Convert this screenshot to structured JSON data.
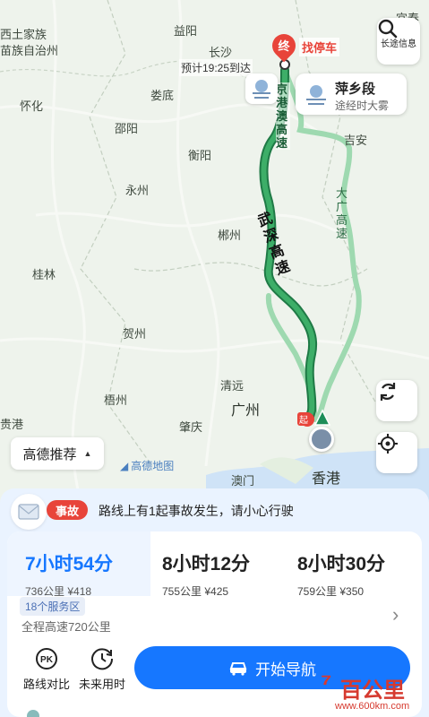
{
  "map": {
    "cities": [
      {
        "name": "西土家族",
        "cls": "city"
      },
      {
        "name": "苗族自治州",
        "cls": "city"
      },
      {
        "name": "益阳",
        "cls": "city"
      },
      {
        "name": "长沙",
        "cls": "city"
      },
      {
        "name": "怀化",
        "cls": "city"
      },
      {
        "name": "娄底",
        "cls": "city"
      },
      {
        "name": "邵阳",
        "cls": "city"
      },
      {
        "name": "衡阳",
        "cls": "city"
      },
      {
        "name": "永州",
        "cls": "city"
      },
      {
        "name": "吉安",
        "cls": "city"
      },
      {
        "name": "郴州",
        "cls": "city"
      },
      {
        "name": "桂林",
        "cls": "city"
      },
      {
        "name": "贺州",
        "cls": "city"
      },
      {
        "name": "梧州",
        "cls": "city"
      },
      {
        "name": "清远",
        "cls": "city"
      },
      {
        "name": "广州",
        "cls": "city-big"
      },
      {
        "name": "肇庆",
        "cls": "city"
      },
      {
        "name": "澳门",
        "cls": "city"
      },
      {
        "name": "香港",
        "cls": "city-big"
      },
      {
        "name": "贵港",
        "cls": "city"
      },
      {
        "name": "宜春",
        "cls": "city"
      },
      {
        "name": "江",
        "cls": "city"
      }
    ],
    "road_labels": {
      "highway_main": "京港澳高速",
      "highway_wushen": "武深高速",
      "highway_daguang": "大广高速"
    },
    "destination_tag": "终",
    "parking_label": "找停车",
    "eta_text": "预计19:25到达",
    "start_tag": "起",
    "logo_text": "高德地图",
    "weather": {
      "title": "萍乡段",
      "subtitle": "途经时大雾"
    },
    "long_trip_label": "长途信息",
    "preference_label": "高德推荐"
  },
  "alert": {
    "tag": "事故",
    "message": "路线上有1起事故发生，请小心行驶"
  },
  "routes": [
    {
      "time": "7小时54分",
      "distance": "736公里",
      "toll": "¥418",
      "selected": true
    },
    {
      "time": "8小时12分",
      "distance": "755公里",
      "toll": "¥425",
      "selected": false
    },
    {
      "time": "8小时30分",
      "distance": "759公里",
      "toll": "¥350",
      "selected": false
    }
  ],
  "route_detail": {
    "service_areas": "18个服务区",
    "highway_km": "全程高速720公里"
  },
  "bottom": {
    "compare_label": "路线对比",
    "future_label": "未来用时",
    "start_nav": "开始导航"
  },
  "watermark": {
    "brand": "百公里",
    "url": "www.600km.com"
  },
  "colors": {
    "accent": "#1677ff",
    "route_selected": "#2e9a5a",
    "route_alt": "#9ed9b0",
    "alert_red": "#e8443a"
  }
}
